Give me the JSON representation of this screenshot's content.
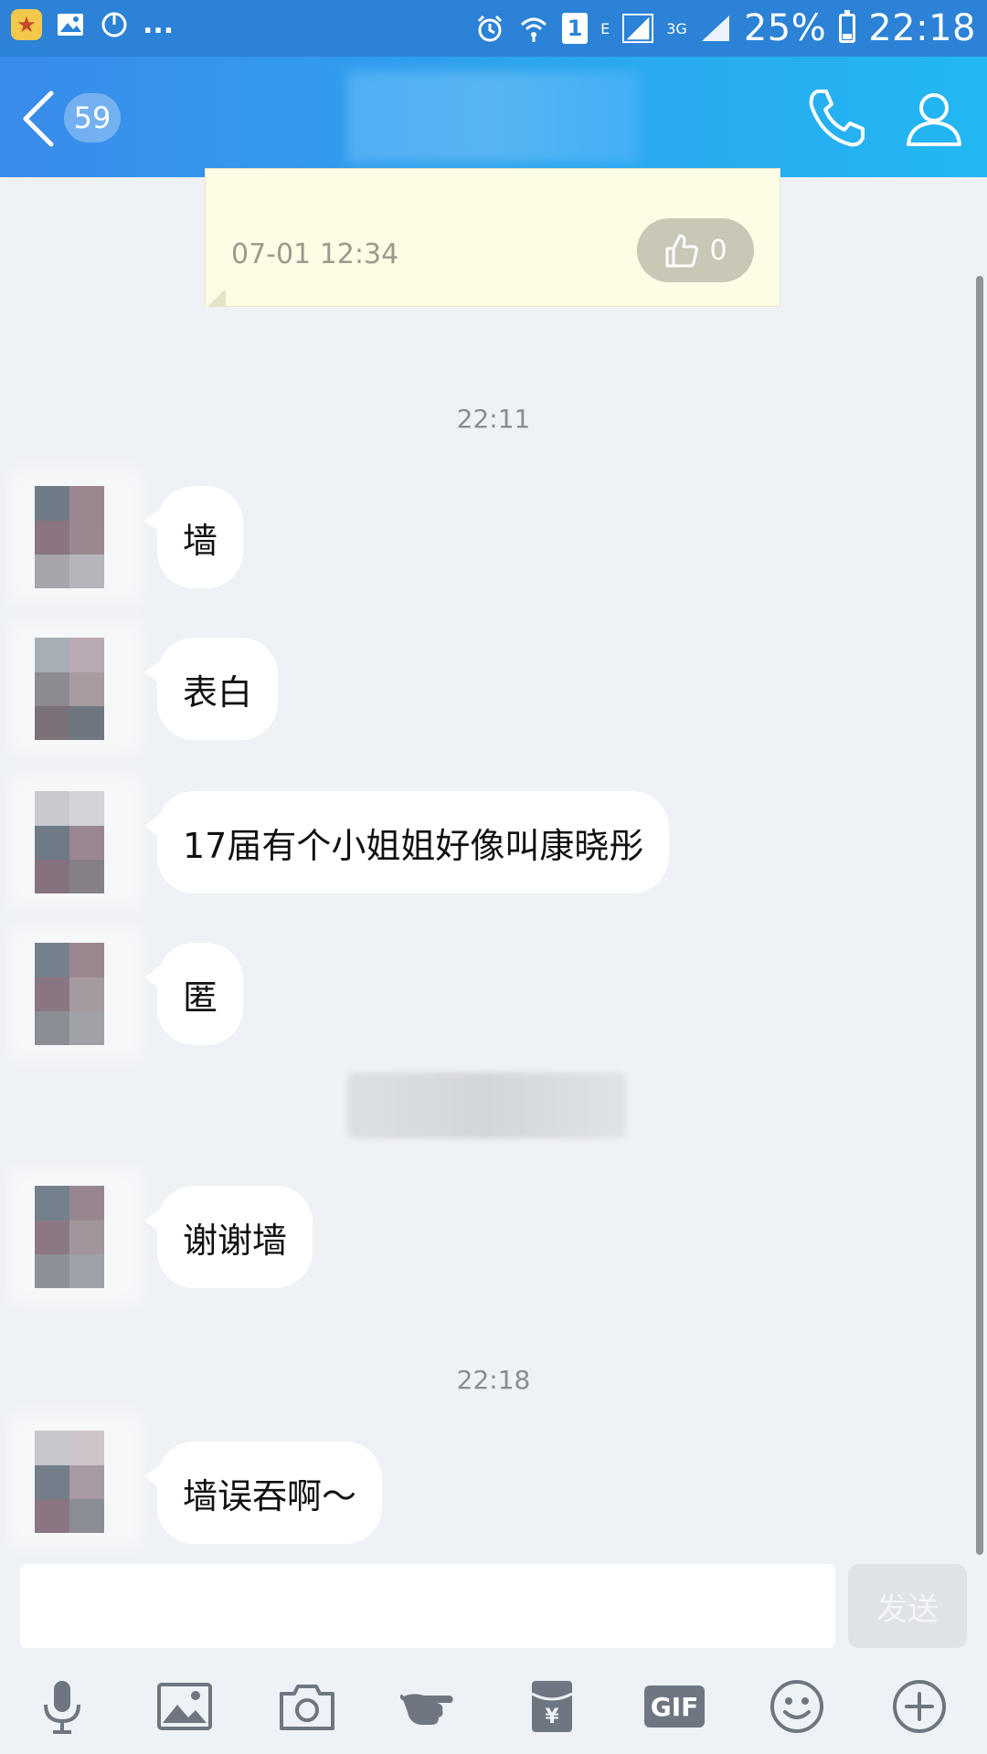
{
  "status_bar": {
    "dots": "...",
    "network_e": "E",
    "network_3g": "3G",
    "sim_slot": "1",
    "battery": "25%",
    "time": "22:18"
  },
  "header": {
    "unread_count": "59"
  },
  "card": {
    "date": "07-01 12:34",
    "likes": "0"
  },
  "chat": {
    "time_separators": [
      "22:11",
      "22:18"
    ],
    "messages": [
      {
        "text": "墙"
      },
      {
        "text": "表白"
      },
      {
        "text": "17届有个小姐姐好像叫康晓彤"
      },
      {
        "text": "匿"
      },
      {
        "text": "谢谢墙"
      },
      {
        "text": "墙误吞啊～"
      }
    ]
  },
  "input": {
    "placeholder": "",
    "send_label": "发送"
  },
  "toolbar": {
    "icons": [
      "microphone-icon",
      "image-icon",
      "camera-icon",
      "poke-hand-icon",
      "red-packet-icon",
      "gif-icon",
      "emoji-icon",
      "plus-icon"
    ],
    "gif_label": "GIF"
  },
  "colors": {
    "header_start": "#3a8bea",
    "header_end": "#22b7f2",
    "chat_bg": "#eef1f5",
    "bubble": "#ffffff",
    "card_bg": "#fdfce5"
  }
}
